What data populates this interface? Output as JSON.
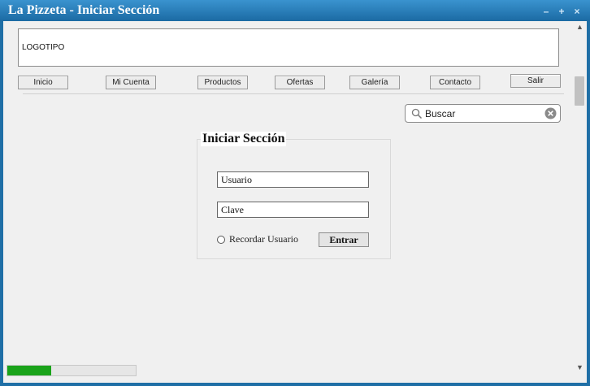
{
  "window": {
    "title": "La Pizzeta - Iniciar Sección",
    "controls": {
      "minimize": "–",
      "maximize": "+",
      "close": "×"
    }
  },
  "header": {
    "logo_text": "LOGOTIPO"
  },
  "nav": {
    "items": [
      {
        "label": "Inicio"
      },
      {
        "label": "Mi Cuenta"
      },
      {
        "label": "Productos"
      },
      {
        "label": "Ofertas"
      },
      {
        "label": "Galería"
      },
      {
        "label": "Contacto"
      },
      {
        "label": "Salir"
      }
    ]
  },
  "search": {
    "value": "Buscar",
    "icon": "search-icon",
    "clear_icon": "clear-icon"
  },
  "login": {
    "title": "Iniciar Sección",
    "username_value": "Usuario",
    "password_value": "Clave",
    "remember_label": "Recordar Usuario",
    "remember_checked": false,
    "submit_label": "Entrar"
  },
  "progress": {
    "fraction": 0.34,
    "color": "#1aa31a"
  },
  "colors": {
    "titlebar": "#1b6aa3",
    "border": "#1f6fa6"
  }
}
